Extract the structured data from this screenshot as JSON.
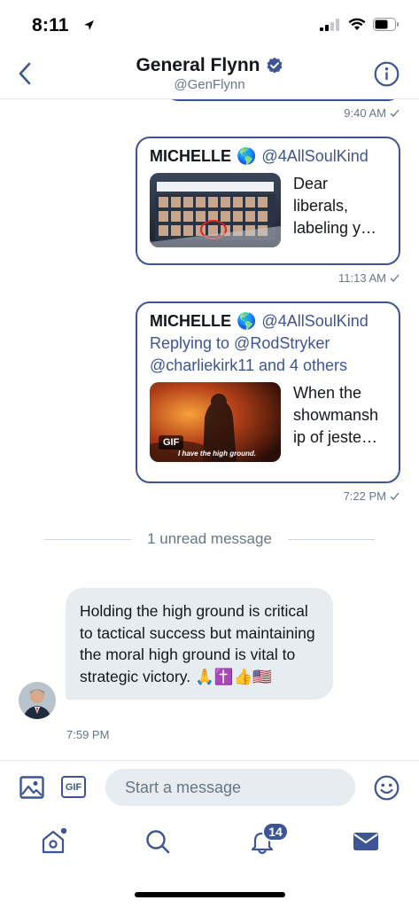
{
  "status_bar": {
    "time": "8:11"
  },
  "header": {
    "name": "General Flynn",
    "handle": "@GenFlynn"
  },
  "messages": {
    "timestamp_1": "9:40 AM",
    "tweet_1": {
      "name": "MICHELLE",
      "handle": "@4AllSoulKind",
      "text": "Dear liberals, labeling y…",
      "image_caption": "POTENTIAL SCOTUS NOMINEES"
    },
    "timestamp_2": "11:13 AM",
    "tweet_2": {
      "name": "MICHELLE",
      "handle": "@4AllSoulKind",
      "reply_line_1": "Replying to @RodStryker",
      "reply_line_2": "@charliekirk11 and 4 others",
      "text": "When the showmansh ip of jeste…",
      "gif_label": "GIF",
      "gif_caption": "I have the high ground."
    },
    "timestamp_3": "7:22 PM",
    "unread_divider": "1 unread message",
    "incoming": {
      "text": "Holding the high ground is critical to tactical success but maintaining the moral high ground is vital to strategic victory. 🙏✝️👍🇺🇸",
      "time": "7:59 PM"
    }
  },
  "compose": {
    "gif_label": "GIF",
    "placeholder": "Start a message"
  },
  "tabbar": {
    "notifications_badge": "14"
  },
  "colors": {
    "accent": "#3d5596",
    "bubble": "#e6ecf0",
    "muted": "#657786"
  },
  "icons": [
    "back-icon",
    "verified-icon",
    "info-icon",
    "image-icon",
    "gif-icon",
    "emoji-icon",
    "home-icon",
    "search-icon",
    "bell-icon",
    "mail-icon"
  ]
}
